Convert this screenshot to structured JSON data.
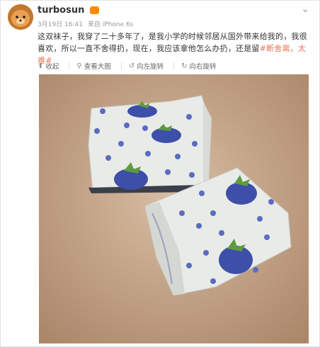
{
  "post": {
    "username": "turbosun",
    "date": "3月19日 16:41",
    "source": "来自 iPhone 6s",
    "text_main": "这双袜子，我穿了二十多年了，是我小学的时候邻居从国外带来给我的，我很喜欢，所以一直不舍得扔，现在，我应该拿他怎么办扔",
    "text_tail": "，还是留",
    "hashtag1": "#断舍离",
    "hashtag_sep": "，",
    "hashtag2": "太难#"
  },
  "toolbar": {
    "collapse": "收起",
    "view_large": "查看大图",
    "rotate_left": "向左旋转",
    "rotate_right": "向右旋转"
  },
  "icons": {
    "collapse": "arrow-up-icon",
    "view_large": "magnifier-icon",
    "rotate_left": "rotate-left-icon",
    "rotate_right": "rotate-right-icon",
    "more": "chevron-down-icon"
  },
  "colors": {
    "hashtag": "#eb7350",
    "sock": "#e9ebe8",
    "strawberry": "#3d4fa8",
    "leaf": "#5f9b3e",
    "dot": "#5a6cc0",
    "floor": "#c9a98b"
  }
}
